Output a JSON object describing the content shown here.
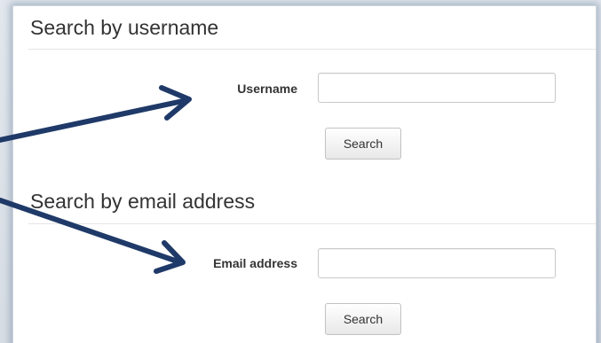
{
  "username_section": {
    "title": "Search by username",
    "label": "Username",
    "input_value": "",
    "search_label": "Search"
  },
  "email_section": {
    "title": "Search by email address",
    "label": "Email address",
    "input_value": "",
    "search_label": "Search"
  },
  "colors": {
    "arrow": "#1f3a68",
    "panel_shadow": "#7d8ca5"
  },
  "annotations": {
    "arrow_icon": "arrow-icon"
  }
}
